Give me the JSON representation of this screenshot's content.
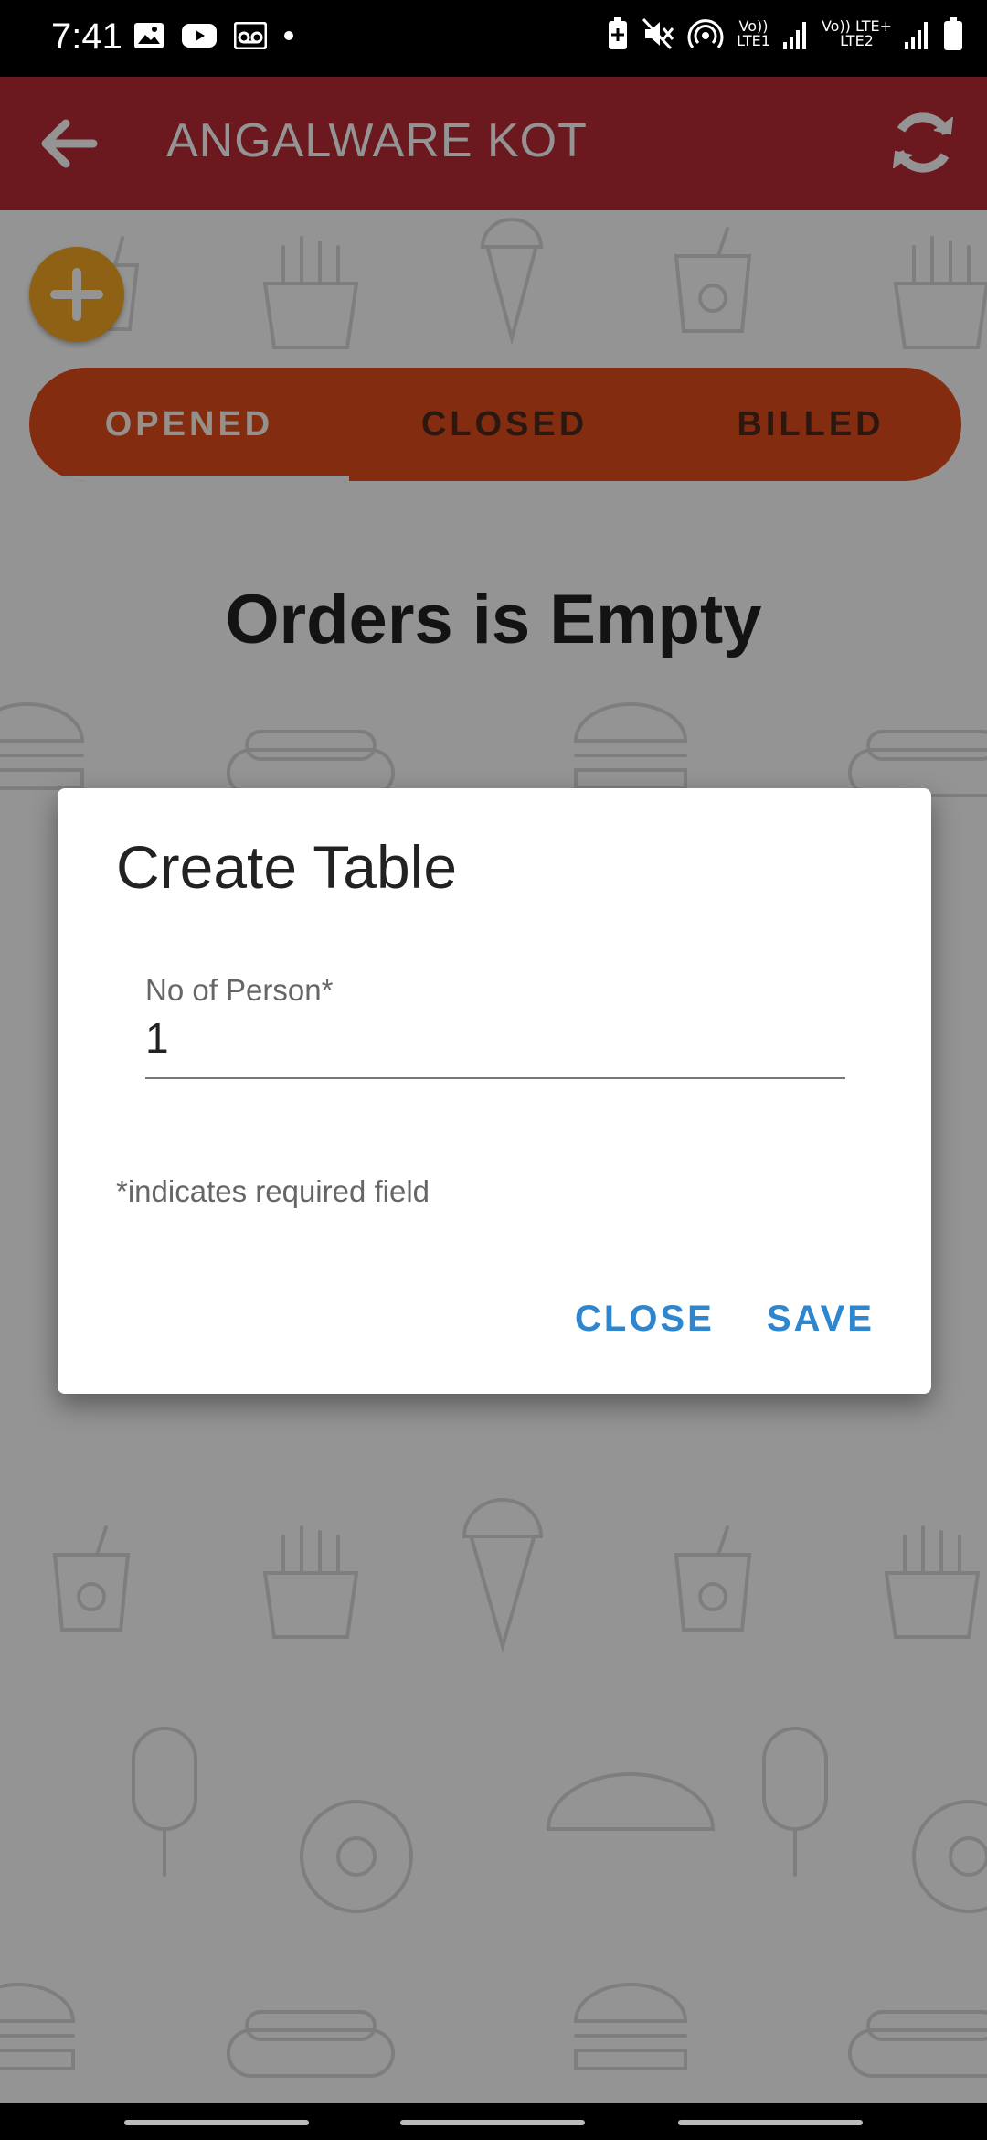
{
  "status_bar": {
    "time": "7:41",
    "left_icons": [
      "gallery-icon",
      "youtube-icon",
      "voicemail-icon",
      "dot-icon"
    ],
    "right_icons": [
      "battery-saver-icon",
      "mute-icon",
      "hotspot-icon",
      "sim1-signal-icon",
      "sim2-signal-icon",
      "battery-icon"
    ],
    "sim1_label_top": "Vo))",
    "sim1_label_bottom": "LTE1",
    "sim2_label_top": "Vo)) LTE+",
    "sim2_label_bottom": "LTE2"
  },
  "app_bar": {
    "title": "ANGALWARE KOT",
    "back_icon": "arrow-back-icon",
    "refresh_icon": "refresh-icon",
    "color": "#b92a35"
  },
  "fab": {
    "icon": "plus-icon",
    "color": "#f4a723"
  },
  "tabs": [
    {
      "label": "OPENED",
      "active": true
    },
    {
      "label": "CLOSED",
      "active": false
    },
    {
      "label": "BILLED",
      "active": false
    }
  ],
  "tabs_color": "#e44d1c",
  "empty_message": "Orders is Empty",
  "dialog": {
    "title": "Create Table",
    "field_label": "No of Person*",
    "field_value": "1",
    "required_note": "*indicates required field",
    "close_label": "CLOSE",
    "save_label": "SAVE",
    "button_color": "#2e86cf"
  }
}
